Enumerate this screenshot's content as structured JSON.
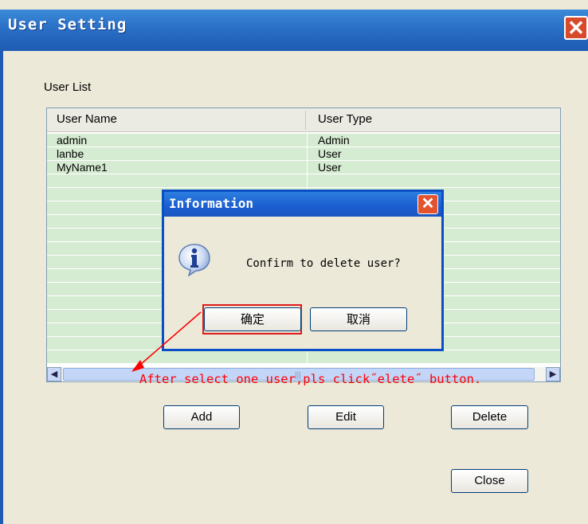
{
  "window": {
    "title": "User Setting"
  },
  "user_list": {
    "caption": "User List",
    "columns": [
      "User Name",
      "User Type"
    ],
    "rows": [
      {
        "name": "admin",
        "type": "Admin"
      },
      {
        "name": "lanbe",
        "type": "User"
      },
      {
        "name": "MyName1",
        "type": "User"
      }
    ]
  },
  "buttons": {
    "add": "Add",
    "edit": "Edit",
    "delete": "Delete",
    "close": "Close"
  },
  "dialog": {
    "title": "Information",
    "message": "Confirm to delete user?",
    "ok": "确定",
    "cancel": "取消",
    "icon": "info-icon"
  },
  "annotation": {
    "text": "After select one user,pls click˝elete˝ button."
  },
  "colors": {
    "row_bg": "#d6ecd2",
    "titlebar": "#1f5bb3",
    "annotation": "#ff0000"
  }
}
